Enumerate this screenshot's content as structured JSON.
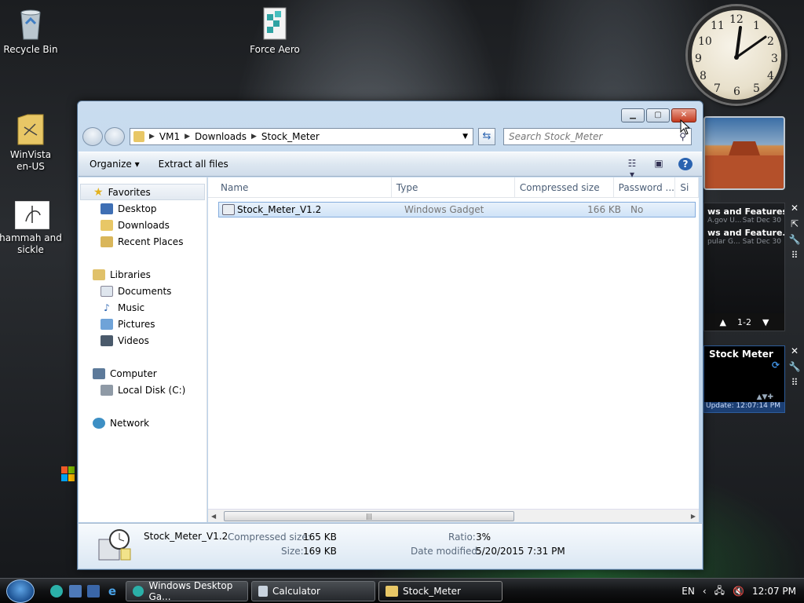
{
  "desktop": {
    "icons": [
      {
        "label": "Recycle Bin"
      },
      {
        "label": "Force Aero"
      },
      {
        "label": "WinVista\nen-US"
      },
      {
        "label": "hammah and\nsickle"
      }
    ]
  },
  "clock": {
    "numerals": [
      "12",
      "1",
      "2",
      "3",
      "4",
      "5",
      "6",
      "7",
      "8",
      "9",
      "10",
      "11"
    ]
  },
  "feeds": {
    "items": [
      {
        "title": "ws and Features f...",
        "source": "A.gov U...",
        "date": "Sat Dec 30"
      },
      {
        "title": "ws and Feature...",
        "source": "pular G...",
        "date": "Sat Dec 30"
      }
    ],
    "pager": "1-2"
  },
  "stock_gadget": {
    "title": "Stock Meter",
    "update": "Update: 12:07:14 PM"
  },
  "window": {
    "breadcrumb": [
      "VM1",
      "Downloads",
      "Stock_Meter"
    ],
    "search_placeholder": "Search Stock_Meter",
    "toolbar": {
      "organize": "Organize",
      "extract": "Extract all files"
    },
    "nav": {
      "favorites": {
        "label": "Favorites",
        "items": [
          "Desktop",
          "Downloads",
          "Recent Places"
        ]
      },
      "libraries": {
        "label": "Libraries",
        "items": [
          "Documents",
          "Music",
          "Pictures",
          "Videos"
        ]
      },
      "computer": {
        "label": "Computer",
        "items": [
          "Local Disk (C:)"
        ]
      },
      "network": {
        "label": "Network"
      }
    },
    "columns": [
      "Name",
      "Type",
      "Compressed size",
      "Password ...",
      "Si"
    ],
    "files": [
      {
        "name": "Stock_Meter_V1.2",
        "type": "Windows Gadget",
        "compressed": "166 KB",
        "password": "No"
      }
    ],
    "details": {
      "name": "Stock_Meter_V1.2",
      "compressed_label": "Compressed size:",
      "compressed_value": "165 KB",
      "size_label": "Size:",
      "size_value": "169 KB",
      "ratio_label": "Ratio:",
      "ratio_value": "3%",
      "modified_label": "Date modified:",
      "modified_value": "5/20/2015 7:31 PM"
    }
  },
  "taskbar": {
    "tasks": [
      "Windows Desktop Ga...",
      "Calculator",
      "Stock_Meter"
    ],
    "lang": "EN",
    "time": "12:07 PM"
  }
}
